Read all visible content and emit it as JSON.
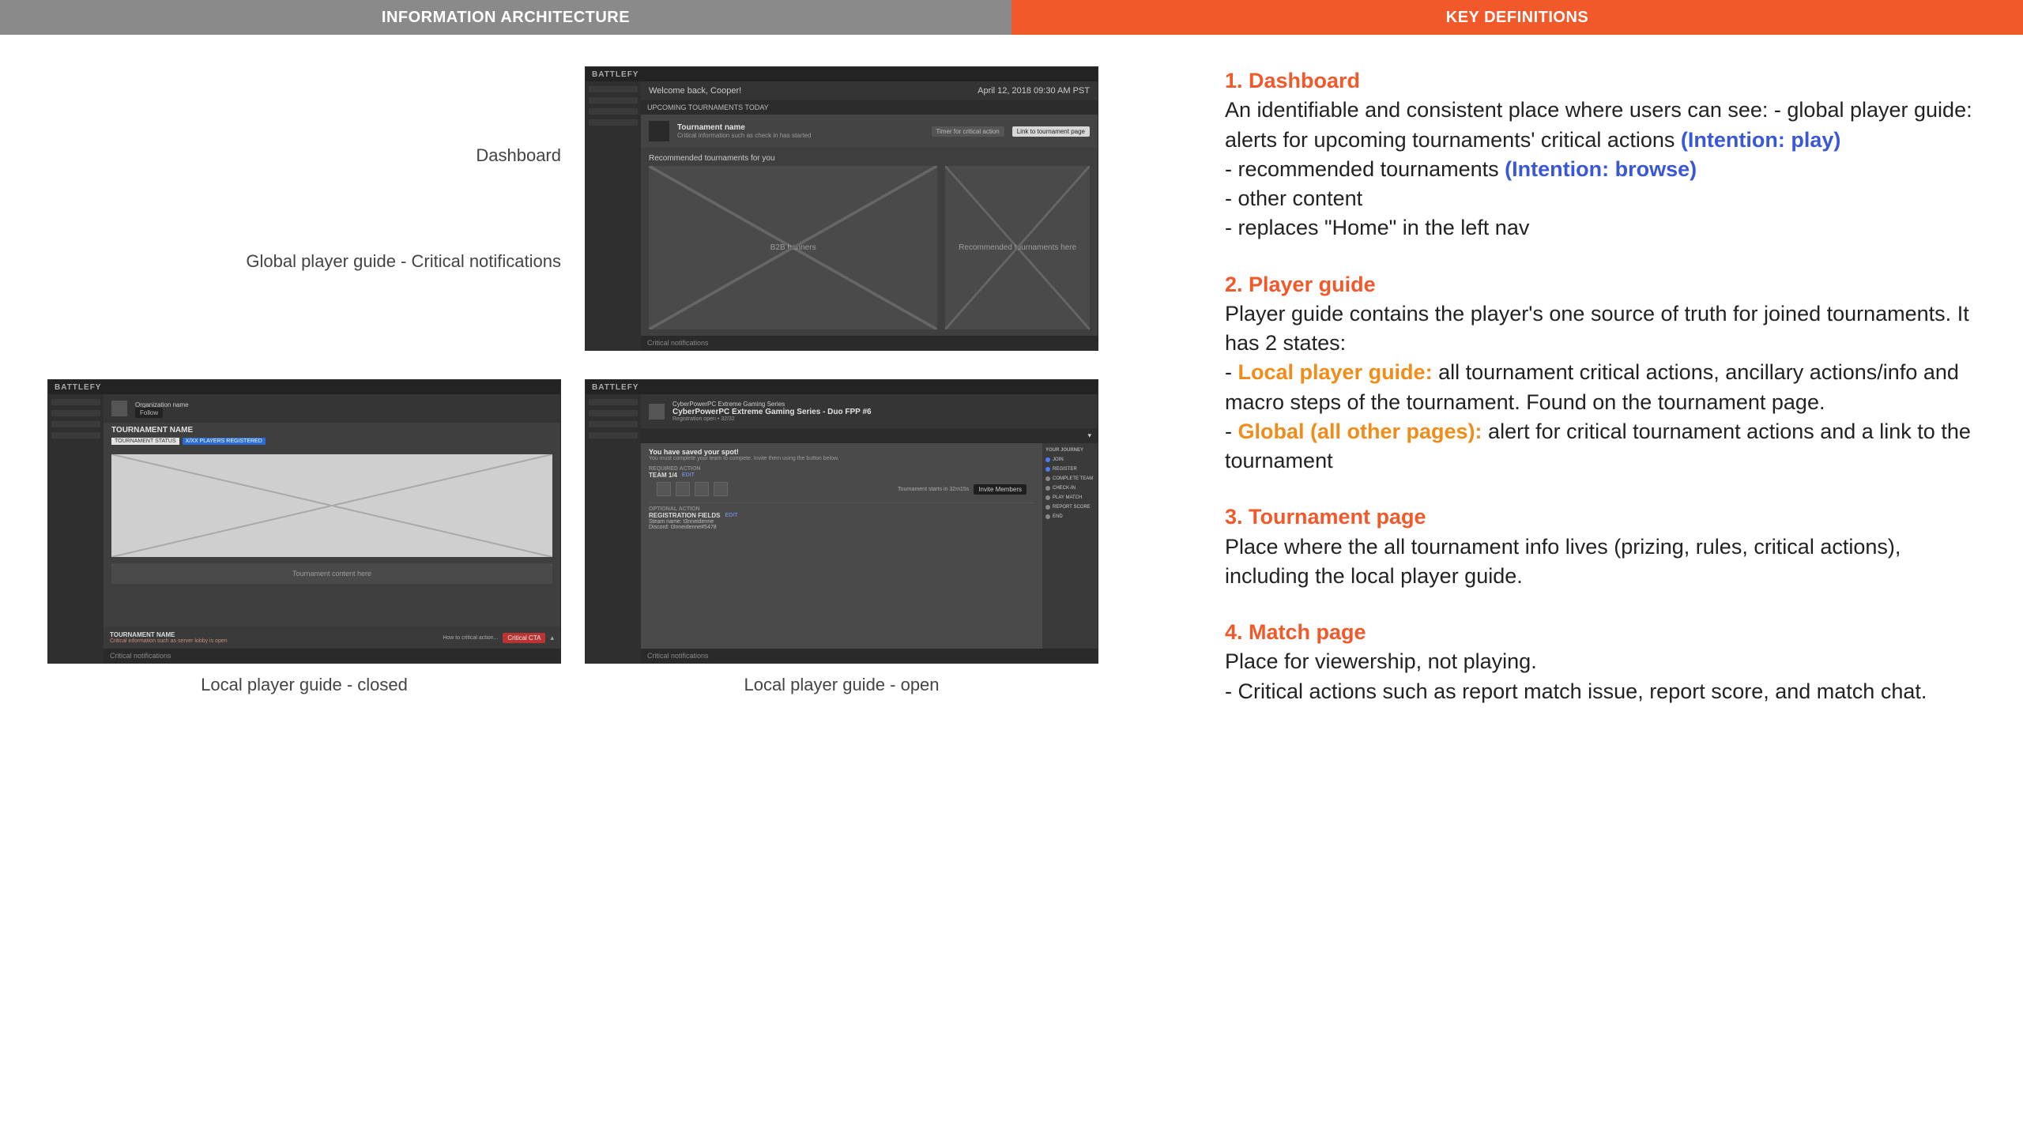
{
  "header": {
    "left": "INFORMATION ARCHITECTURE",
    "right": "KEY DEFINITIONS"
  },
  "left": {
    "labels": {
      "dashboard": "Dashboard",
      "global_guide": "Global player guide - Critical notifications",
      "local_closed": "Local player guide - closed",
      "local_open": "Local player guide - open"
    },
    "mock_dashboard": {
      "brand": "BATTLEFY",
      "welcome": "Welcome back, Cooper!",
      "date": "April 12, 2018    09:30 AM PST",
      "upcoming": "UPCOMING TOURNAMENTS TODAY",
      "tname": "Tournament name",
      "tinfo": "Critical information such as check in has started",
      "timer": "Timer for critical action",
      "link": "Link to tournament page",
      "rec_title": "Recommended tournaments for you",
      "b2b": "B2B banners",
      "rec_here": "Recommended tournaments here",
      "footer": "Critical notifications"
    },
    "mock_closed": {
      "brand": "BATTLEFY",
      "org": "Organization name",
      "follow": "Follow",
      "title": "TOURNAMENT NAME",
      "tag1": "TOURNAMENT STATUS",
      "tag2": "X/XX PLAYERS REGISTERED",
      "content": "Tournament content here",
      "foot_name": "TOURNAMENT NAME",
      "foot_info": "Critical information such as server lobby is open",
      "foot_how": "How to critical action...",
      "foot_cta": "Critical CTA",
      "notif": "Critical notifications"
    },
    "mock_open": {
      "brand": "BATTLEFY",
      "org": "CyberPowerPC Extreme Gaming Series",
      "title": "CyberPowerPC Extreme Gaming Series - Duo FPP #6",
      "reg": "Registration open  •  32/32",
      "saved": "You have saved your spot!",
      "saved_sub": "You must complete your team to compete. Invite them using the button below.",
      "required": "REQUIRED ACTION",
      "team": "TEAM 1/4",
      "team_edit": "EDIT",
      "starts": "Tournament starts in 32m15s",
      "invite": "Invite Members",
      "optional": "OPTIONAL ACTION",
      "regfields": "REGISTRATION FIELDS",
      "edit": "EDIT",
      "steam": "Steam name: t3nneidenne",
      "discord": "Discord: t3nneidenne#5478",
      "journey_title": "YOUR JOURNEY",
      "j1": "JOIN",
      "j2": "REGISTER",
      "j3": "COMPLETE TEAM",
      "j4": "CHECK-IN",
      "j5": "PLAY MATCH",
      "j6": "REPORT SCORE",
      "j7": "END",
      "notif": "Critical notifications"
    }
  },
  "defs": {
    "d1": {
      "title": "1. Dashboard",
      "p1a": "An identifiable and consistent place where users can see: - global player guide: alerts for upcoming tournaments' critical actions ",
      "p1b": "(Intention: play)",
      "p2a": "- recommended tournaments ",
      "p2b": "(Intention: browse)",
      "p3": "- other content",
      "p4": "- replaces \"Home\" in the left nav"
    },
    "d2": {
      "title": "2. Player guide",
      "p1": "Player guide contains the player's one source of truth for joined tournaments. It has 2 states:",
      "local_label": "Local player guide:",
      "local_text": " all tournament critical actions, ancillary actions/info and macro steps of the tournament. Found on the tournament page.",
      "global_label": "Global (all other pages):",
      "global_text": " alert for critical tournament actions and a link to the tournament"
    },
    "d3": {
      "title": "3. Tournament page",
      "p1": "Place where the all tournament info lives (prizing, rules, critical actions), including the local player guide."
    },
    "d4": {
      "title": "4. Match page",
      "p1": "Place for viewership, not playing.",
      "p2": "- Critical actions such as report match issue, report score, and match chat."
    }
  }
}
